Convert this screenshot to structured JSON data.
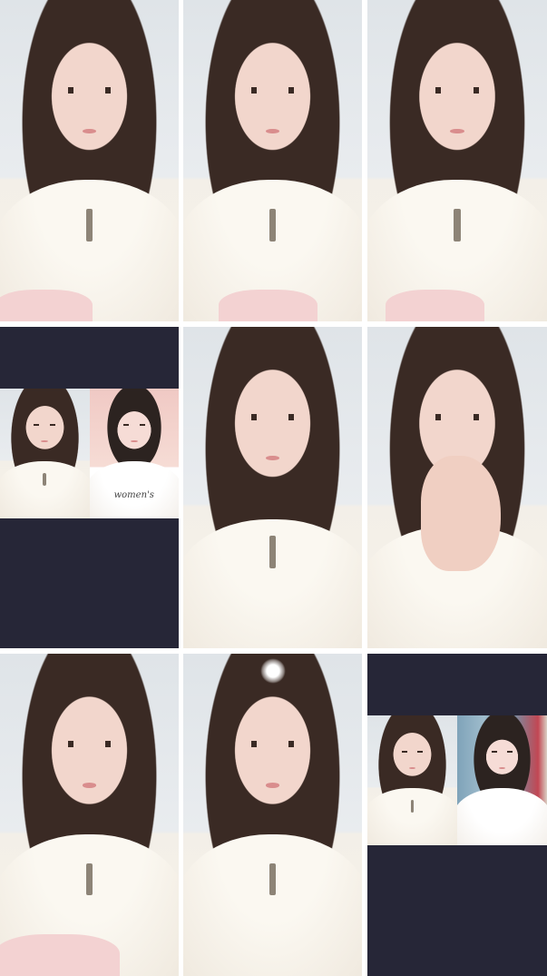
{
  "grid": {
    "rows": 3,
    "columns": 3,
    "tiles": [
      {
        "id": "tile-1",
        "kind": "single-camera"
      },
      {
        "id": "tile-2",
        "kind": "single-camera"
      },
      {
        "id": "tile-3",
        "kind": "single-camera"
      },
      {
        "id": "tile-4",
        "kind": "split-call"
      },
      {
        "id": "tile-5",
        "kind": "single-camera"
      },
      {
        "id": "tile-6",
        "kind": "single-camera"
      },
      {
        "id": "tile-7",
        "kind": "single-camera"
      },
      {
        "id": "tile-8",
        "kind": "single-camera"
      },
      {
        "id": "tile-9",
        "kind": "split-call"
      }
    ]
  },
  "shirt_print": "women's",
  "colors": {
    "tile_background": "#262637",
    "page_background": "#ffffff"
  }
}
